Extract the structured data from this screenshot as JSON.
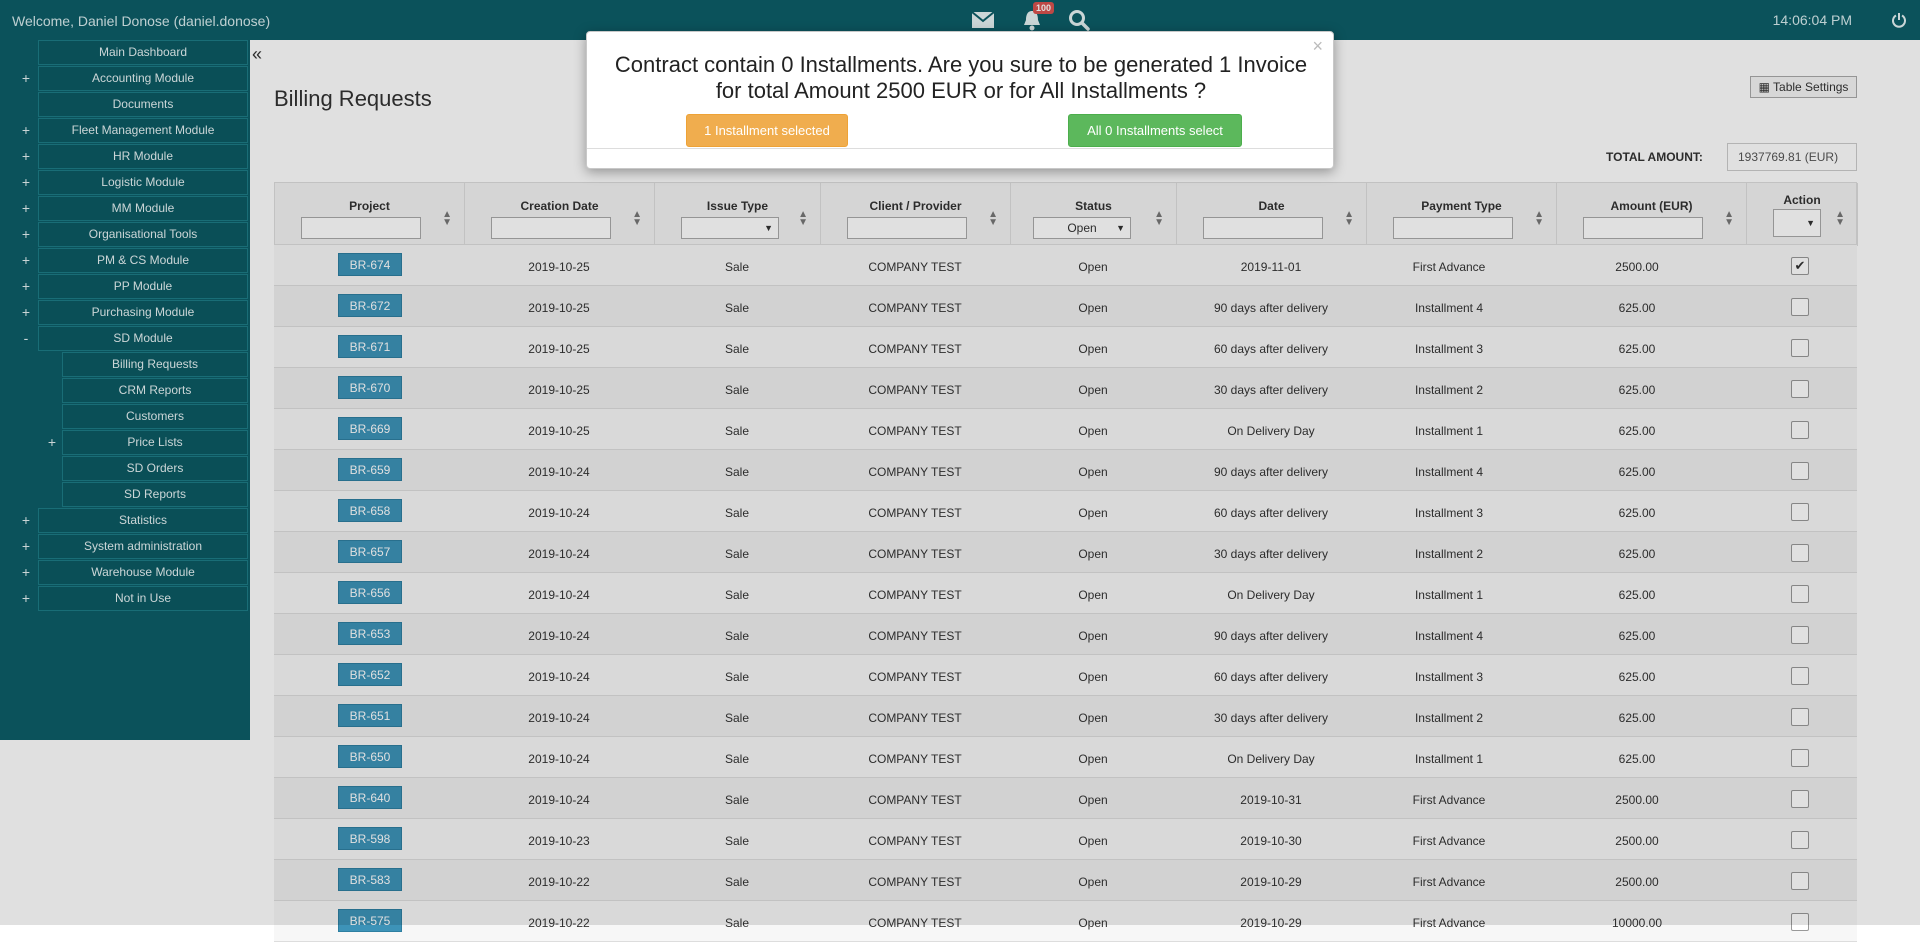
{
  "topbar": {
    "welcome": "Welcome, Daniel Donose (daniel.donose)",
    "notifications_count": "100",
    "time": "14:06:04 PM",
    "icons": [
      "mail-icon",
      "bell-icon",
      "search-icon",
      "power-icon"
    ]
  },
  "sidebar": {
    "items": [
      {
        "label": "Main Dashboard",
        "prefix": ""
      },
      {
        "label": "Accounting Module",
        "prefix": "+"
      },
      {
        "label": "Documents",
        "prefix": ""
      },
      {
        "label": "Fleet Management Module",
        "prefix": "+"
      },
      {
        "label": "HR Module",
        "prefix": "+"
      },
      {
        "label": "Logistic Module",
        "prefix": "+"
      },
      {
        "label": "MM Module",
        "prefix": "+"
      },
      {
        "label": "Organisational Tools",
        "prefix": "+"
      },
      {
        "label": "PM & CS Module",
        "prefix": "+"
      },
      {
        "label": "PP Module",
        "prefix": "+"
      },
      {
        "label": "Purchasing Module",
        "prefix": "+"
      },
      {
        "label": "SD Module",
        "prefix": "-"
      }
    ],
    "sd_subitems": [
      {
        "label": "Billing Requests",
        "prefix": ""
      },
      {
        "label": "CRM Reports",
        "prefix": ""
      },
      {
        "label": "Customers",
        "prefix": ""
      },
      {
        "label": "Price Lists",
        "prefix": "+"
      },
      {
        "label": "SD Orders",
        "prefix": ""
      },
      {
        "label": "SD Reports",
        "prefix": ""
      }
    ],
    "items_after": [
      {
        "label": "Statistics",
        "prefix": "+"
      },
      {
        "label": "System administration",
        "prefix": "+"
      },
      {
        "label": "Warehouse Module",
        "prefix": "+"
      },
      {
        "label": "Not in Use",
        "prefix": "+"
      }
    ]
  },
  "main": {
    "title": "Billing Requests",
    "table_settings_label": "Table Settings",
    "total_label": "TOTAL AMOUNT:",
    "total_value": "1937769.81   (EUR)"
  },
  "table": {
    "columns": [
      "Project",
      "Creation Date",
      "Issue Type",
      "Client / Provider",
      "Status",
      "Date",
      "Payment Type",
      "Amount (EUR)",
      "Action"
    ],
    "status_filter_value": "Open",
    "rows": [
      {
        "project": "BR-674",
        "created": "2019-10-25",
        "issue": "Sale",
        "client": "COMPANY TEST",
        "status": "Open",
        "date": "2019-11-01",
        "payment": "First Advance",
        "amount": "2500.00",
        "checked": true
      },
      {
        "project": "BR-672",
        "created": "2019-10-25",
        "issue": "Sale",
        "client": "COMPANY TEST",
        "status": "Open",
        "date": "90 days after delivery",
        "payment": "Installment 4",
        "amount": "625.00",
        "checked": false
      },
      {
        "project": "BR-671",
        "created": "2019-10-25",
        "issue": "Sale",
        "client": "COMPANY TEST",
        "status": "Open",
        "date": "60 days after delivery",
        "payment": "Installment 3",
        "amount": "625.00",
        "checked": false
      },
      {
        "project": "BR-670",
        "created": "2019-10-25",
        "issue": "Sale",
        "client": "COMPANY TEST",
        "status": "Open",
        "date": "30 days after delivery",
        "payment": "Installment 2",
        "amount": "625.00",
        "checked": false
      },
      {
        "project": "BR-669",
        "created": "2019-10-25",
        "issue": "Sale",
        "client": "COMPANY TEST",
        "status": "Open",
        "date": "On Delivery Day",
        "payment": "Installment 1",
        "amount": "625.00",
        "checked": false
      },
      {
        "project": "BR-659",
        "created": "2019-10-24",
        "issue": "Sale",
        "client": "COMPANY TEST",
        "status": "Open",
        "date": "90 days after delivery",
        "payment": "Installment 4",
        "amount": "625.00",
        "checked": false
      },
      {
        "project": "BR-658",
        "created": "2019-10-24",
        "issue": "Sale",
        "client": "COMPANY TEST",
        "status": "Open",
        "date": "60 days after delivery",
        "payment": "Installment 3",
        "amount": "625.00",
        "checked": false
      },
      {
        "project": "BR-657",
        "created": "2019-10-24",
        "issue": "Sale",
        "client": "COMPANY TEST",
        "status": "Open",
        "date": "30 days after delivery",
        "payment": "Installment 2",
        "amount": "625.00",
        "checked": false
      },
      {
        "project": "BR-656",
        "created": "2019-10-24",
        "issue": "Sale",
        "client": "COMPANY TEST",
        "status": "Open",
        "date": "On Delivery Day",
        "payment": "Installment 1",
        "amount": "625.00",
        "checked": false
      },
      {
        "project": "BR-653",
        "created": "2019-10-24",
        "issue": "Sale",
        "client": "COMPANY TEST",
        "status": "Open",
        "date": "90 days after delivery",
        "payment": "Installment 4",
        "amount": "625.00",
        "checked": false
      },
      {
        "project": "BR-652",
        "created": "2019-10-24",
        "issue": "Sale",
        "client": "COMPANY TEST",
        "status": "Open",
        "date": "60 days after delivery",
        "payment": "Installment 3",
        "amount": "625.00",
        "checked": false
      },
      {
        "project": "BR-651",
        "created": "2019-10-24",
        "issue": "Sale",
        "client": "COMPANY TEST",
        "status": "Open",
        "date": "30 days after delivery",
        "payment": "Installment 2",
        "amount": "625.00",
        "checked": false
      },
      {
        "project": "BR-650",
        "created": "2019-10-24",
        "issue": "Sale",
        "client": "COMPANY TEST",
        "status": "Open",
        "date": "On Delivery Day",
        "payment": "Installment 1",
        "amount": "625.00",
        "checked": false
      },
      {
        "project": "BR-640",
        "created": "2019-10-24",
        "issue": "Sale",
        "client": "COMPANY TEST",
        "status": "Open",
        "date": "2019-10-31",
        "payment": "First Advance",
        "amount": "2500.00",
        "checked": false
      },
      {
        "project": "BR-598",
        "created": "2019-10-23",
        "issue": "Sale",
        "client": "COMPANY TEST",
        "status": "Open",
        "date": "2019-10-30",
        "payment": "First Advance",
        "amount": "2500.00",
        "checked": false
      },
      {
        "project": "BR-583",
        "created": "2019-10-22",
        "issue": "Sale",
        "client": "COMPANY TEST",
        "status": "Open",
        "date": "2019-10-29",
        "payment": "First Advance",
        "amount": "2500.00",
        "checked": false
      },
      {
        "project": "BR-575",
        "created": "2019-10-22",
        "issue": "Sale",
        "client": "COMPANY TEST",
        "status": "Open",
        "date": "2019-10-29",
        "payment": "First Advance",
        "amount": "10000.00",
        "checked": false
      }
    ]
  },
  "modal": {
    "message": "Contract contain 0 Installments. Are you sure to be generated 1 Invoice for total Amount 2500 EUR or for All Installments ?",
    "close_label": "×",
    "btn_one": "1 Installment selected",
    "btn_all": "All 0 Installments select"
  },
  "colors": {
    "sidebar_bg": "#0d5e68",
    "br_button": "#3d93b8",
    "orange": "#f0ad4e",
    "green": "#5cb85c"
  }
}
